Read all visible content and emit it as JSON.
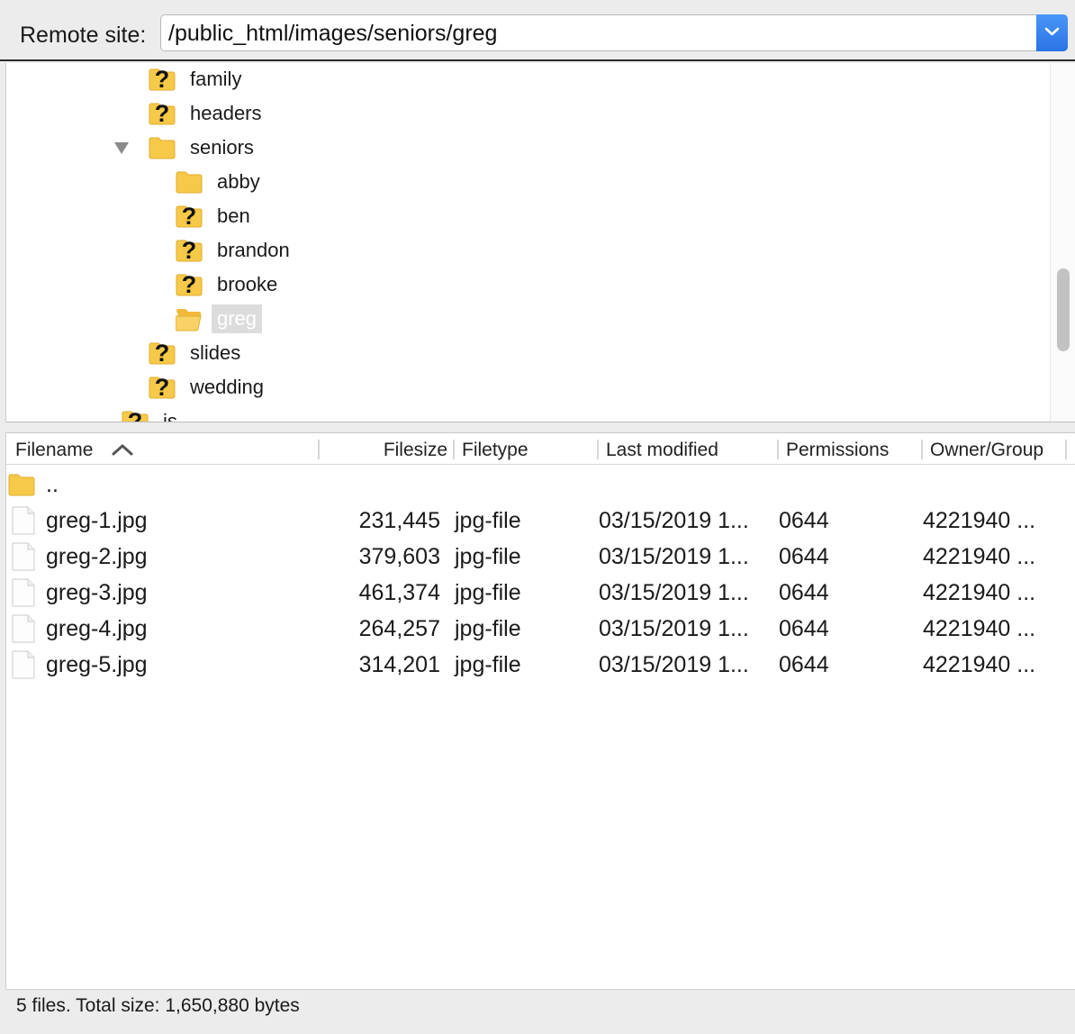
{
  "remote_site": {
    "label": "Remote site:",
    "path": "/public_html/images/seniors/greg"
  },
  "tree": {
    "items": [
      {
        "label": "family",
        "icon": "unknown-folder-icon",
        "depth": 1
      },
      {
        "label": "headers",
        "icon": "unknown-folder-icon",
        "depth": 1
      },
      {
        "label": "seniors",
        "icon": "folder-icon",
        "depth": 1,
        "expanded": true
      },
      {
        "label": "abby",
        "icon": "folder-icon",
        "depth": 2
      },
      {
        "label": "ben",
        "icon": "unknown-folder-icon",
        "depth": 2
      },
      {
        "label": "brandon",
        "icon": "unknown-folder-icon",
        "depth": 2
      },
      {
        "label": "brooke",
        "icon": "unknown-folder-icon",
        "depth": 2
      },
      {
        "label": "greg",
        "icon": "open-folder-icon",
        "depth": 2,
        "selected": true
      },
      {
        "label": "slides",
        "icon": "unknown-folder-icon",
        "depth": 1
      },
      {
        "label": "wedding",
        "icon": "unknown-folder-icon",
        "depth": 1
      },
      {
        "label": "js",
        "icon": "unknown-folder-icon",
        "depth": 0
      }
    ]
  },
  "file_list": {
    "columns": {
      "filename": "Filename",
      "filesize": "Filesize",
      "filetype": "Filetype",
      "last_modified": "Last modified",
      "permissions": "Permissions",
      "owner_group": "Owner/Group"
    },
    "sort_icon": "sort-ascending-icon",
    "parent_row": {
      "name": "..",
      "icon": "folder-icon"
    },
    "rows": [
      {
        "name": "greg-1.jpg",
        "size": "231,445",
        "type": "jpg-file",
        "modified": "03/15/2019 1...",
        "perms": "0644",
        "owner": "4221940 ..."
      },
      {
        "name": "greg-2.jpg",
        "size": "379,603",
        "type": "jpg-file",
        "modified": "03/15/2019 1...",
        "perms": "0644",
        "owner": "4221940 ..."
      },
      {
        "name": "greg-3.jpg",
        "size": "461,374",
        "type": "jpg-file",
        "modified": "03/15/2019 1...",
        "perms": "0644",
        "owner": "4221940 ..."
      },
      {
        "name": "greg-4.jpg",
        "size": "264,257",
        "type": "jpg-file",
        "modified": "03/15/2019 1...",
        "perms": "0644",
        "owner": "4221940 ..."
      },
      {
        "name": "greg-5.jpg",
        "size": "314,201",
        "type": "jpg-file",
        "modified": "03/15/2019 1...",
        "perms": "0644",
        "owner": "4221940 ..."
      }
    ]
  },
  "status": {
    "text": "5 files. Total size: 1,650,880 bytes"
  },
  "colors": {
    "folder": "#f7c948",
    "accent": "#2f7ef0",
    "selection": "#dcdcdc"
  }
}
